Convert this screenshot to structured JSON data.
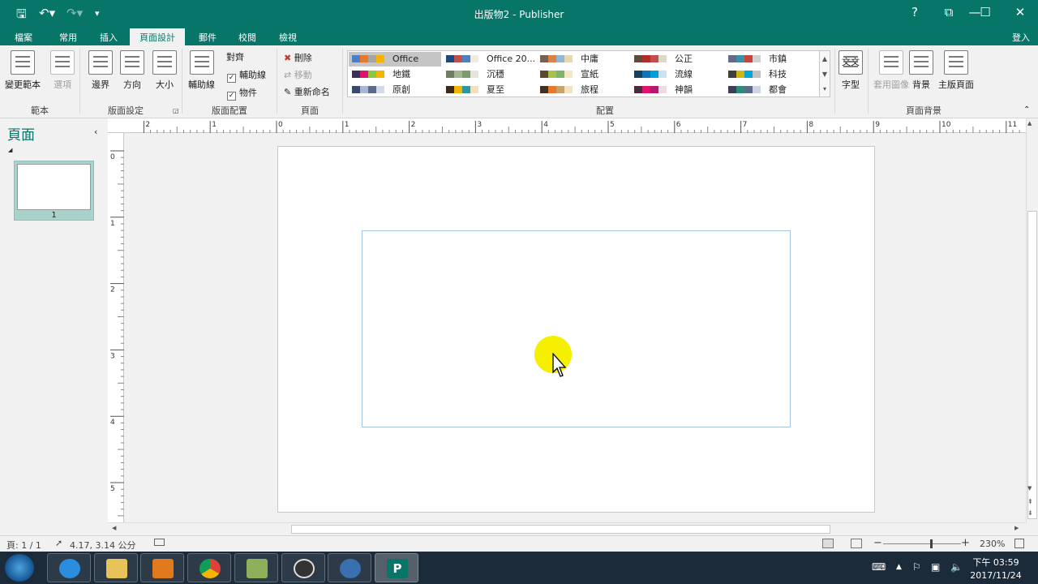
{
  "titlebar": {
    "title": "出版物2 - Publisher",
    "help": "?",
    "signin": "登入"
  },
  "tabs": [
    "檔案",
    "常用",
    "插入",
    "頁面設計",
    "郵件",
    "校閱",
    "檢視"
  ],
  "ribbon": {
    "templates": {
      "change": "變更範本",
      "options": "選項",
      "group": "範本"
    },
    "page_setup": {
      "margins": "邊界",
      "orientation": "方向",
      "size": "大小",
      "group": "版面設定"
    },
    "layout": {
      "guides": "輔助線",
      "align": "對齊",
      "guides_check": "輔助線",
      "objects_check": "物件",
      "group": "版面配置"
    },
    "pages": {
      "delete": "刪除",
      "move": "移動",
      "rename": "重新命名",
      "group": "頁面"
    },
    "schemes": {
      "group": "配置",
      "items": [
        {
          "label": "Office",
          "colors": [
            "#4e7fc2",
            "#e8792c",
            "#a5a5a5",
            "#f4b400"
          ]
        },
        {
          "label": "Office 20...",
          "colors": [
            "#1f497d",
            "#c0504d",
            "#4f81bd",
            "#eeece1"
          ]
        },
        {
          "label": "中庸",
          "colors": [
            "#775f55",
            "#dd8047",
            "#94b6d2",
            "#e7d8b1"
          ]
        },
        {
          "label": "公正",
          "colors": [
            "#5d4b3c",
            "#b52b27",
            "#c0504d",
            "#ddd9c3"
          ]
        },
        {
          "label": "市鎮",
          "colors": [
            "#646b86",
            "#3c8fa8",
            "#c4463a",
            "#d1d1d1"
          ]
        },
        {
          "label": "地鐵",
          "colors": [
            "#3b3059",
            "#e2116d",
            "#8dc63f",
            "#f4b400"
          ]
        },
        {
          "label": "沉穩",
          "colors": [
            "#6f7e63",
            "#a4b592",
            "#7c9c6b",
            "#e2e7d9"
          ]
        },
        {
          "label": "宣紙",
          "colors": [
            "#5a4a32",
            "#a5c249",
            "#7fb36b",
            "#f4e7c2"
          ]
        },
        {
          "label": "流線",
          "colors": [
            "#16405b",
            "#0e75b8",
            "#00a0dd",
            "#c9e1f2"
          ]
        },
        {
          "label": "科技",
          "colors": [
            "#3f3f3f",
            "#d1b40c",
            "#00a6d6",
            "#c2c2c2"
          ]
        },
        {
          "label": "原創",
          "colors": [
            "#3b4a6b",
            "#aab7d0",
            "#5b6b8c",
            "#d3dbe8"
          ]
        },
        {
          "label": "夏至",
          "colors": [
            "#3d2918",
            "#f4b400",
            "#2f94a3",
            "#f0e0c0"
          ]
        },
        {
          "label": "旅程",
          "colors": [
            "#403028",
            "#e8792c",
            "#c9a46a",
            "#f3e1c1"
          ]
        },
        {
          "label": "神韻",
          "colors": [
            "#4a2a3c",
            "#e2116d",
            "#b8186b",
            "#f2d8e6"
          ]
        },
        {
          "label": "都會",
          "colors": [
            "#3c3f54",
            "#2e8b7a",
            "#5a6b8c",
            "#cfd5e3"
          ]
        }
      ]
    },
    "fonts": {
      "label": "字型",
      "glyph": "文文"
    },
    "page_background": {
      "apply_image": "套用圖像",
      "background": "背景",
      "master": "主版頁面",
      "group": "頁面背景"
    }
  },
  "pages_panel": {
    "title": "頁面",
    "page_number": "1"
  },
  "ruler_top": [
    "2",
    "1",
    "0",
    "1",
    "2",
    "3",
    "4",
    "5",
    "6",
    "7",
    "8",
    "9",
    "10",
    "11"
  ],
  "ruler_left": [
    "0",
    "1",
    "2",
    "3",
    "4",
    "5"
  ],
  "statusbar": {
    "page": "頁: 1 / 1",
    "position": "4.17, 3.14 公分",
    "zoom": "230%",
    "zoom_level": 0.62
  },
  "taskbar": {
    "time": "下午 03:59",
    "date": "2017/11/24"
  }
}
